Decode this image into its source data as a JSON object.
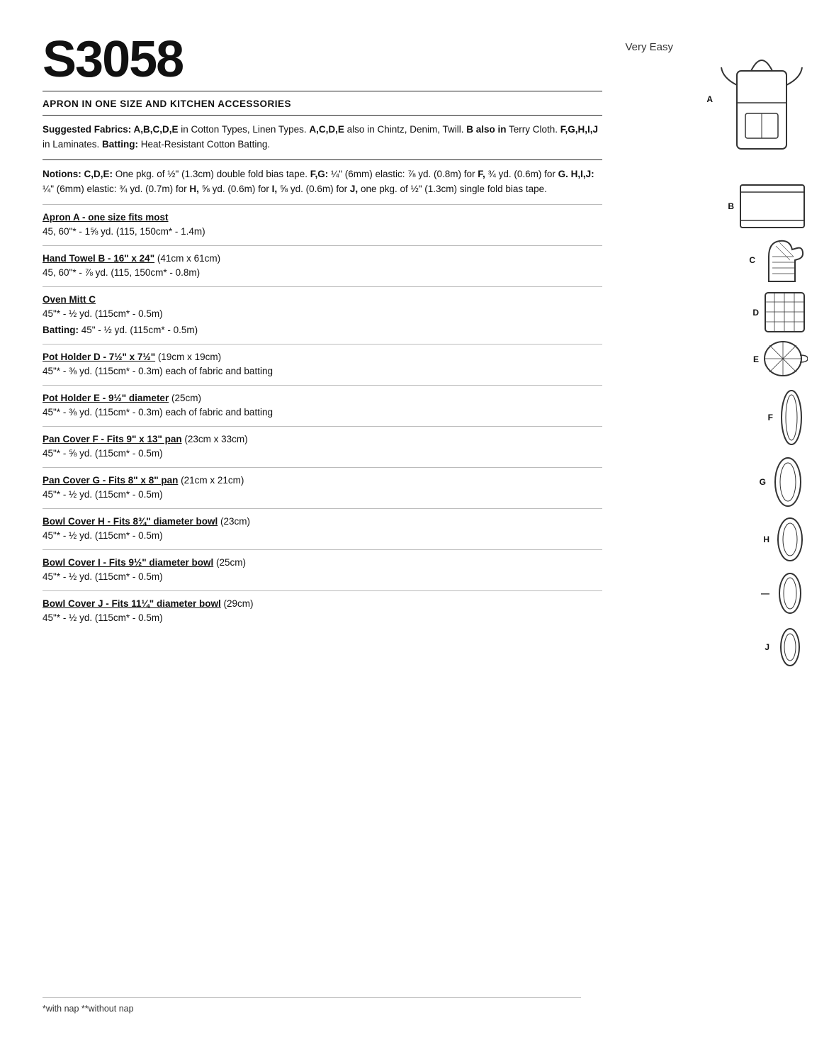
{
  "header": {
    "pattern_number": "S3058",
    "difficulty": "Very Easy",
    "title": "APRON IN ONE SIZE AND KITCHEN ACCESSORIES"
  },
  "fabrics": {
    "label": "Suggested Fabrics:",
    "text": "A,B,C,D,E in Cotton Types, Linen Types. A,C,D,E also in Chintz, Denim, Twill. B also in Terry Cloth. F,G,H,I,J in Laminates. Batting: Heat-Resistant Cotton Batting."
  },
  "notions": {
    "label": "Notions:",
    "text": "C,D,E: One pkg. of ½\" (1.3cm) double fold bias tape. F,G: ¼\" (6mm) elastic: ⅞ yd. (0.8m) for F, ¾ yd. (0.6m) for G. H,I,J: ¼\" (6mm) elastic: ¾ yd. (0.7m) for H, ⅝ yd. (0.6m) for I, ⅝ yd. (0.6m) for J, one pkg. of ½\" (1.3cm) single fold bias tape."
  },
  "sections": [
    {
      "id": "A",
      "title": "Apron A - one size fits most",
      "lines": [
        "45, 60\"* - 1⅝ yd. (115, 150cm* - 1.4m)"
      ]
    },
    {
      "id": "B",
      "title": "Hand Towel B - 16\" x 24\"",
      "title_suffix": " (41cm x 61cm)",
      "lines": [
        "45, 60\"* - ⅞ yd. (115, 150cm* - 0.8m)"
      ]
    },
    {
      "id": "C",
      "title": "Oven Mitt C",
      "lines": [
        "45\"* - ½ yd. (115cm* - 0.5m)",
        "Batting: 45\" - ½ yd. (115cm* - 0.5m)"
      ]
    },
    {
      "id": "D",
      "title": "Pot Holder D - 7½\" x 7½\"",
      "title_suffix": " (19cm x 19cm)",
      "lines": [
        "45\"* - ⅜ yd. (115cm* - 0.3m) each of fabric and batting"
      ]
    },
    {
      "id": "E",
      "title": "Pot Holder E - 9½\" diameter",
      "title_suffix": " (25cm)",
      "lines": [
        "45\"* - ⅜ yd. (115cm* - 0.3m) each of fabric and batting"
      ]
    },
    {
      "id": "F",
      "title": "Pan Cover F - Fits 9\" x 13\" pan",
      "title_suffix": " (23cm x 33cm)",
      "lines": [
        "45\"* - ⅝  yd. (115cm* - 0.5m)"
      ]
    },
    {
      "id": "G",
      "title": "Pan Cover G - Fits 8\" x 8\" pan",
      "title_suffix": " (21cm x 21cm)",
      "lines": [
        "45\"* - ½ yd. (115cm* - 0.5m)"
      ]
    },
    {
      "id": "H",
      "title": "Bowl Cover H - Fits 8¾\" diameter bowl",
      "title_suffix": " (23cm)",
      "lines": [
        "45\"* - ½ yd. (115cm* - 0.5m)"
      ]
    },
    {
      "id": "I",
      "title": "Bowl Cover I - Fits 9½\" diameter bowl",
      "title_suffix": " (25cm)",
      "lines": [
        "45\"* - ½ yd. (115cm* - 0.5m)"
      ]
    },
    {
      "id": "J",
      "title": "Bowl Cover J - Fits 11¼\" diameter bowl",
      "title_suffix": " (29cm)",
      "lines": [
        "45\"* - ½ yd. (115cm* - 0.5m)"
      ]
    }
  ],
  "footnote": "*with nap    **without nap",
  "sidebar_labels": {
    "A": "A",
    "B": "B",
    "C": "C",
    "D": "D",
    "E": "E",
    "F": "F",
    "G": "G",
    "H": "H",
    "I": "I",
    "J": "J"
  }
}
